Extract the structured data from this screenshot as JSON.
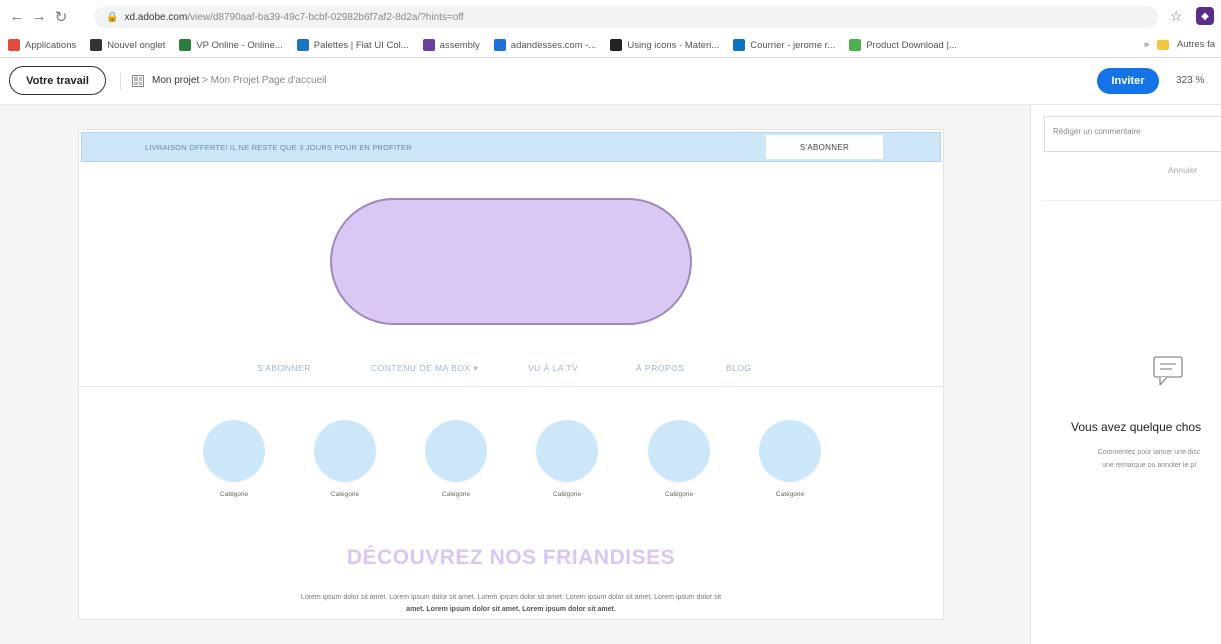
{
  "browser": {
    "url_domain": "xd.adobe.com",
    "url_path": "/view/d8790aaf-ba39-49c7-bcbf-02982b6f7af2-8d2a/?hints=off",
    "bookmarks": [
      {
        "label": "Applications",
        "color": "#e14a3c"
      },
      {
        "label": "Nouvel onglet",
        "color": "#333333"
      },
      {
        "label": "VP Online - Online...",
        "color": "#2d7d3a"
      },
      {
        "label": "Palettes | Flat UI Col...",
        "color": "#1e73be"
      },
      {
        "label": "assembly",
        "color": "#6b3fa0"
      },
      {
        "label": "adandesses.com -...",
        "color": "#1e6fd9"
      },
      {
        "label": "Using icons · Materi...",
        "color": "#222222"
      },
      {
        "label": "Courrier - jerome r...",
        "color": "#0b72c6"
      },
      {
        "label": "Product Download |...",
        "color": "#4caf50"
      }
    ],
    "bookmarks_more": "»",
    "other_bookmarks": "Autres fa"
  },
  "xd": {
    "work_button": "Votre travail",
    "breadcrumb_project": "Mon projet",
    "breadcrumb_sep": ">",
    "breadcrumb_page": "Mon Projet Page d'accueil",
    "invite_button": "Inviter",
    "zoom": "323 %"
  },
  "artboard": {
    "promo_text": "LIVRAISON OFFERTE! IL NE RESTE QUE 3 JOURS POUR EN PROFITER",
    "promo_button": "S'ABONNER",
    "nav": [
      "S'ABONNER",
      "CONTENU DE MA BOX ▾",
      "VU À LA TV",
      "À PROPOS",
      "BLOG"
    ],
    "categories": [
      "Catégorie",
      "Catégorie",
      "Catégorie",
      "Catégorie",
      "Catégorie",
      "Catégorie"
    ],
    "heading": "DÉCOUVREZ NOS FRIANDISES",
    "lorem_line1": "Lorem ipsum dolor sit amet. Lorem ipsum dolor sit amet. Lorem ipsum dolor sit amet. Lorem ipsum dolor sit amet. Lorem ipsum dolor sit",
    "lorem_line2": "amet. Lorem ipsum dolor sit amet. Lorem ipsum dolor sit amet."
  },
  "panel": {
    "comment_placeholder": "Rédiger un commentaire",
    "cancel": "Annuler",
    "empty_title": "Vous avez quelque chos",
    "empty_desc_line1": "Commentez pour lancer une disc",
    "empty_desc_line2": "une remarque ou annoter le pl"
  },
  "colors": {
    "accent": "#1473e6",
    "promo_bg": "#cce6f8",
    "logo_fill": "#d9c7f4",
    "category_circle": "#cde7fa"
  }
}
